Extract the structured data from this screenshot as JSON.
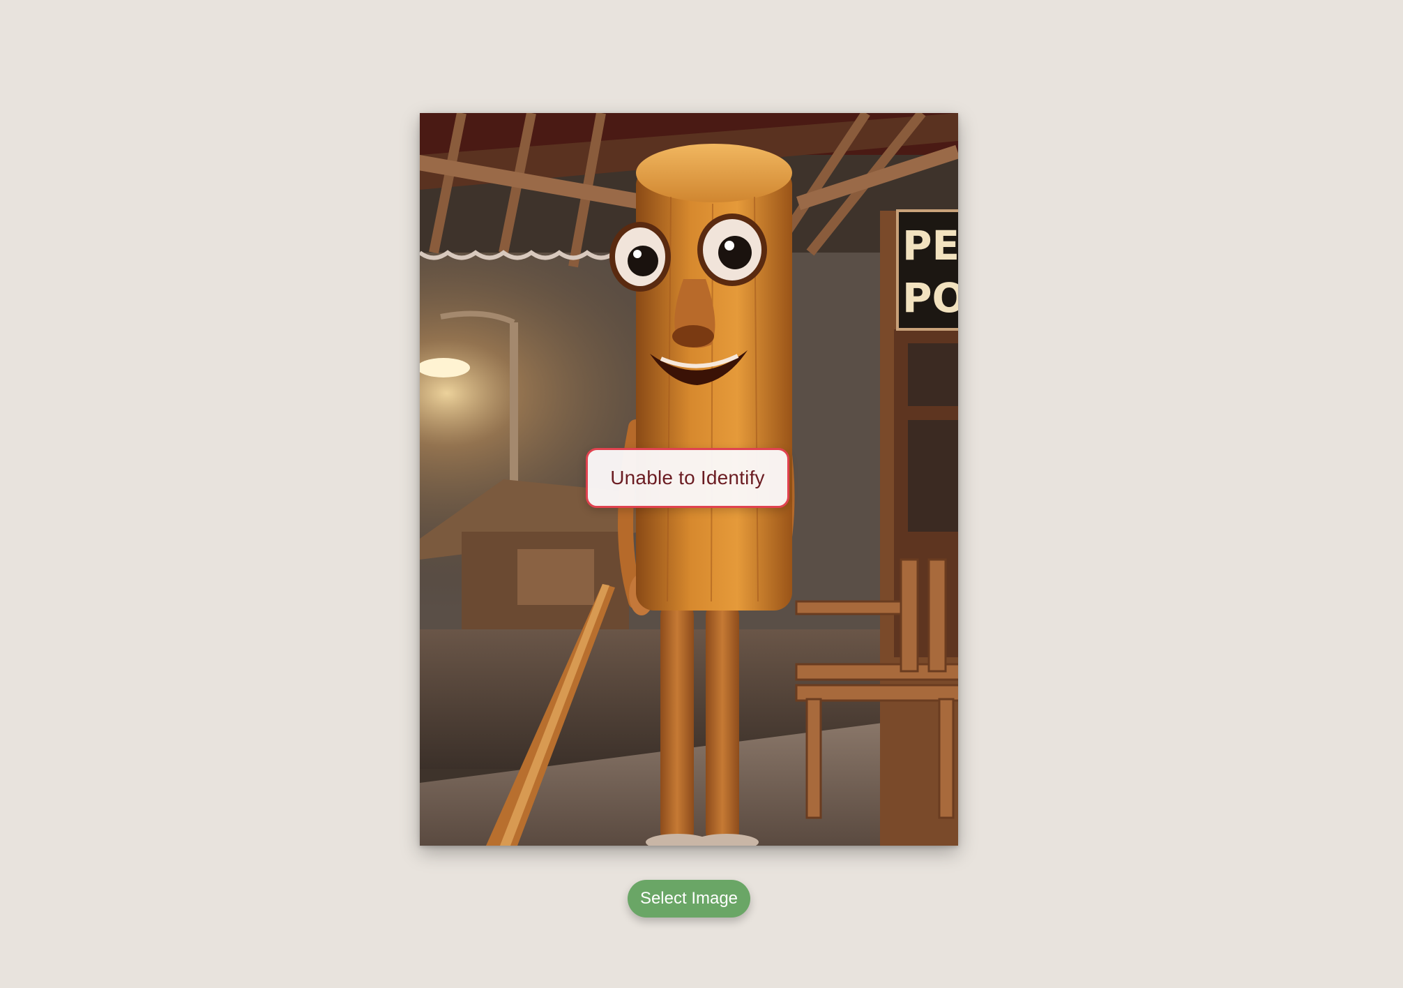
{
  "photo": {
    "subject": "wooden-figure",
    "sign_line_1": "PEN",
    "sign_line_2": "POS"
  },
  "result": {
    "label": "Unable to Identify",
    "border_color": "#e0424f",
    "text_color": "#6b1c22"
  },
  "actions": {
    "select_label": "Select Image",
    "button_color": "#6aa666"
  },
  "colors": {
    "page_background": "#e8e3dd"
  }
}
